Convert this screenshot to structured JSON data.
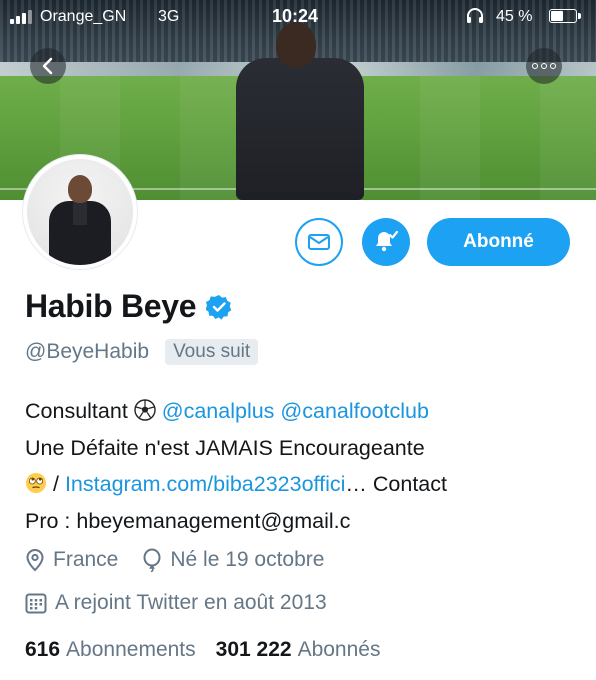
{
  "status_bar": {
    "carrier": "Orange_GN",
    "network": "3G",
    "time": "10:24",
    "battery_percent": "45 %",
    "battery_level": 0.45
  },
  "header": {
    "back_icon": "chevron-left-icon",
    "more_icon": "more-horizontal-icon"
  },
  "actions": {
    "message_icon": "mail-icon",
    "notifications_icon": "bell-check-icon",
    "follow_label": "Abonné"
  },
  "profile": {
    "name": "Habib Beye",
    "verified": true,
    "handle": "@BeyeHabib",
    "follows_you": "Vous suit",
    "bio": {
      "line1_prefix": "Consultant",
      "line1_emoji": "soccer-ball-icon",
      "mention1": "@canalplus",
      "mention2": "@canalfootclub",
      "line2": "Une Défaite n'est JAMAIS Encourageante",
      "line3_emoji": "eye-roll-emoji-icon",
      "line3_sep": "/",
      "link": "Instagram.com/biba2323offici",
      "line3_suffix": "… Contact",
      "line4": "Pro : hbeyemanagement@gmail.c"
    },
    "location": "France",
    "birthday": "Né le 19 octobre",
    "joined": "A rejoint Twitter en août 2013",
    "following_count": "616",
    "following_label": "Abonnements",
    "followers_count": "301 222",
    "followers_label": "Abonnés"
  },
  "colors": {
    "accent": "#1da1f2",
    "link": "#1b95e0",
    "secondary_text": "#657786",
    "primary_text": "#14171a"
  }
}
